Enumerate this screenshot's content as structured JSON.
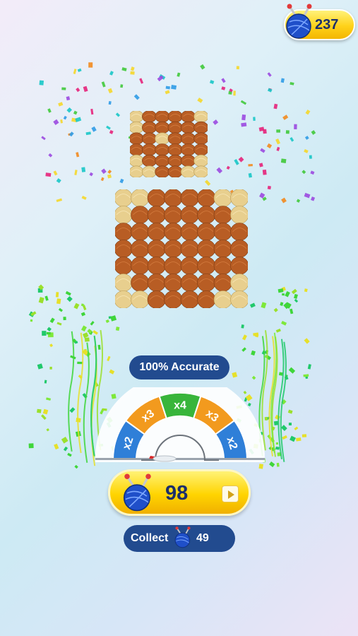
{
  "currency": {
    "balance": "237",
    "icon": "yarn-ball-icon"
  },
  "result": {
    "accuracy_label": "100% Accurate"
  },
  "multiplier": {
    "segments": [
      "x2",
      "x3",
      "x4",
      "x3",
      "x2"
    ],
    "colors": {
      "x2": "#2f7fd8",
      "x3": "#f29a1e",
      "x4": "#38b53b"
    }
  },
  "reward": {
    "amount": "98",
    "icon": "yarn-ball-icon",
    "action_icon": "play-video-icon"
  },
  "collect": {
    "label": "Collect",
    "amount": "49",
    "icon": "yarn-ball-icon"
  },
  "palette": {
    "yarn_brown": "#b85d24",
    "yarn_beige": "#e8cf8e",
    "button_yellow": "#ffd400",
    "pill_navy": "#224b8f"
  }
}
